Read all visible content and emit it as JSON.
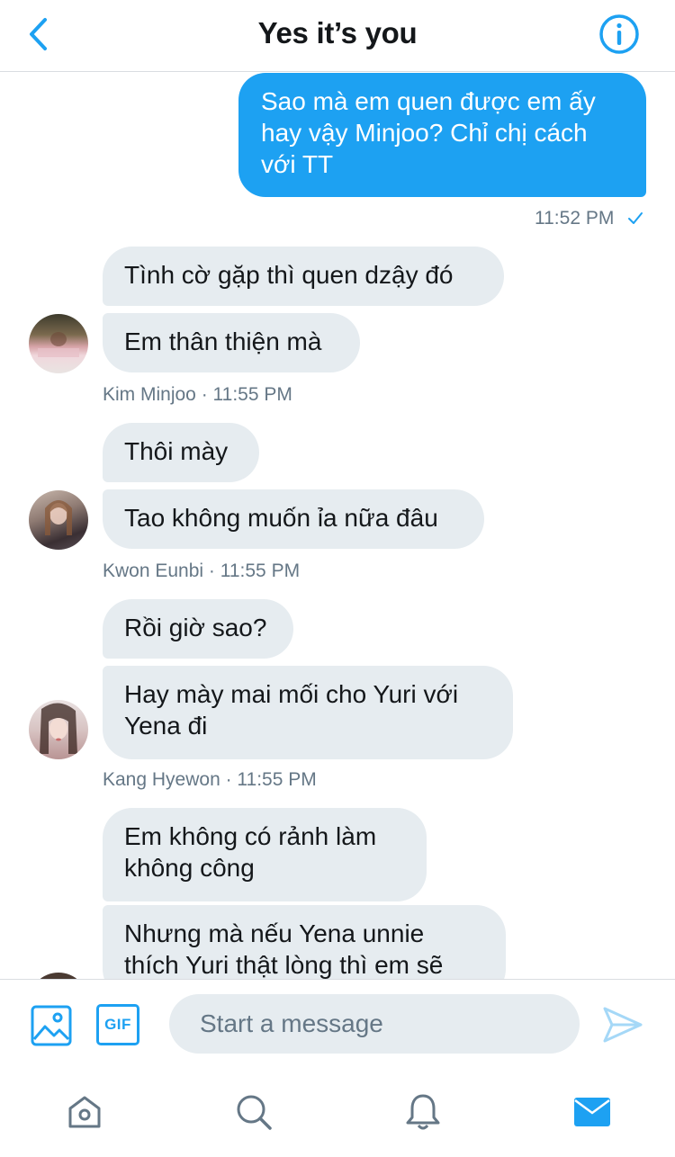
{
  "header": {
    "title": "Yes it’s you"
  },
  "messages": {
    "outgoing": {
      "text": "Sao mà em quen được em ấy\nhay vậy Minjoo? Chỉ chị cách\nvới TT",
      "time": "11:52 PM",
      "status_icon": "checkmark-icon"
    },
    "groups": [
      {
        "sender": "Kim Minjoo",
        "bubbles": [
          "Tình cờ gặp thì quen dzậy đó",
          "Em thân thiện mà"
        ],
        "meta": "Kim Minjoo · 11:55 PM"
      },
      {
        "sender": "Kwon Eunbi",
        "bubbles": [
          "Thôi mày",
          "Tao không muốn ỉa nữa đâu"
        ],
        "meta": "Kwon Eunbi · 11:55 PM"
      },
      {
        "sender": "Kang Hyewon",
        "bubbles": [
          "Rồi giờ sao?",
          "Hay mày mai mối cho Yuri với\nYena đi"
        ],
        "meta": "Kang Hyewon · 11:55 PM"
      },
      {
        "bubbles": [
          "Em không có rảnh làm\nkhông công",
          "Nhưng mà nếu Yena unnie\nthích Yuri thật lòng thì em sẽ"
        ]
      }
    ]
  },
  "composer": {
    "placeholder": "Start a message",
    "gif_label": "GIF"
  },
  "colors": {
    "accent": "#1da1f2",
    "incoming_bubble": "#e6ecf0",
    "meta_text": "#657786"
  },
  "tabbar": {
    "items": [
      "home-icon",
      "search-icon",
      "bell-icon",
      "mail-icon"
    ],
    "active": "mail-icon"
  }
}
